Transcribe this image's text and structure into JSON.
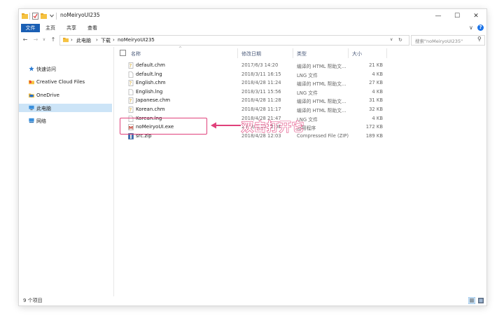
{
  "window": {
    "title": "noMeiryoUI235",
    "controls": {
      "minimize": "—",
      "maximize": "☐",
      "close": "✕"
    }
  },
  "ribbon": {
    "file_tab": "文件",
    "tabs": [
      "主页",
      "共享",
      "查看"
    ],
    "collapse": "∨",
    "help": "?"
  },
  "addressbar": {
    "back": "←",
    "forward": "→",
    "recent": "∨",
    "up": "↑",
    "crumbs": [
      "此电脑",
      "下载",
      "noMeiryoUI235"
    ],
    "sep": "›",
    "dropdown": "∨",
    "refresh": "↻"
  },
  "search": {
    "placeholder": "搜索\"noMeiryoUI235\"",
    "icon": "⚲"
  },
  "nav": {
    "items": [
      {
        "label": "快速访问",
        "icon": "star-icon"
      },
      {
        "label": "Creative Cloud Files",
        "icon": "cloud-folder-icon"
      },
      {
        "label": "OneDrive",
        "icon": "onedrive-icon"
      },
      {
        "label": "此电脑",
        "icon": "pc-icon"
      },
      {
        "label": "网络",
        "icon": "network-icon"
      }
    ],
    "selected_index": 3
  },
  "columns": {
    "name": "名称",
    "date": "修改日期",
    "type": "类型",
    "size": "大小"
  },
  "files": [
    {
      "name": "default.chm",
      "date": "2017/6/3 14:20",
      "type": "编译的 HTML 帮助文...",
      "size": "21 KB",
      "icon": "chm-icon"
    },
    {
      "name": "default.lng",
      "date": "2018/3/11 16:15",
      "type": "LNG 文件",
      "size": "4 KB",
      "icon": "file-icon"
    },
    {
      "name": "English.chm",
      "date": "2018/4/28 11:24",
      "type": "编译的 HTML 帮助文...",
      "size": "27 KB",
      "icon": "chm-icon"
    },
    {
      "name": "English.lng",
      "date": "2018/3/11 15:56",
      "type": "LNG 文件",
      "size": "4 KB",
      "icon": "file-icon"
    },
    {
      "name": "Japanese.chm",
      "date": "2018/4/28 11:28",
      "type": "编译的 HTML 帮助文...",
      "size": "31 KB",
      "icon": "chm-icon"
    },
    {
      "name": "Korean.chm",
      "date": "2018/4/28 11:17",
      "type": "编译的 HTML 帮助文...",
      "size": "32 KB",
      "icon": "chm-icon"
    },
    {
      "name": "Korean.lng",
      "date": "2018/4/28 21:47",
      "type": "LNG 文件",
      "size": "4 KB",
      "icon": "file-icon"
    },
    {
      "name": "noMeiryoUI.exe",
      "date": "2018/4/28 12:08",
      "type": "应用程序",
      "size": "172 KB",
      "icon": "exe-icon"
    },
    {
      "name": "src.zip",
      "date": "2018/4/28 12:03",
      "type": "Compressed File (ZIP)",
      "size": "189 KB",
      "icon": "zip-icon"
    }
  ],
  "annotation": {
    "text": "双击打开它",
    "color": "#e0417b"
  },
  "status": {
    "count": "9 个项目"
  },
  "colors": {
    "accent": "#1a5fb4",
    "selection": "#cce4f7",
    "annotation": "#e0417b"
  }
}
